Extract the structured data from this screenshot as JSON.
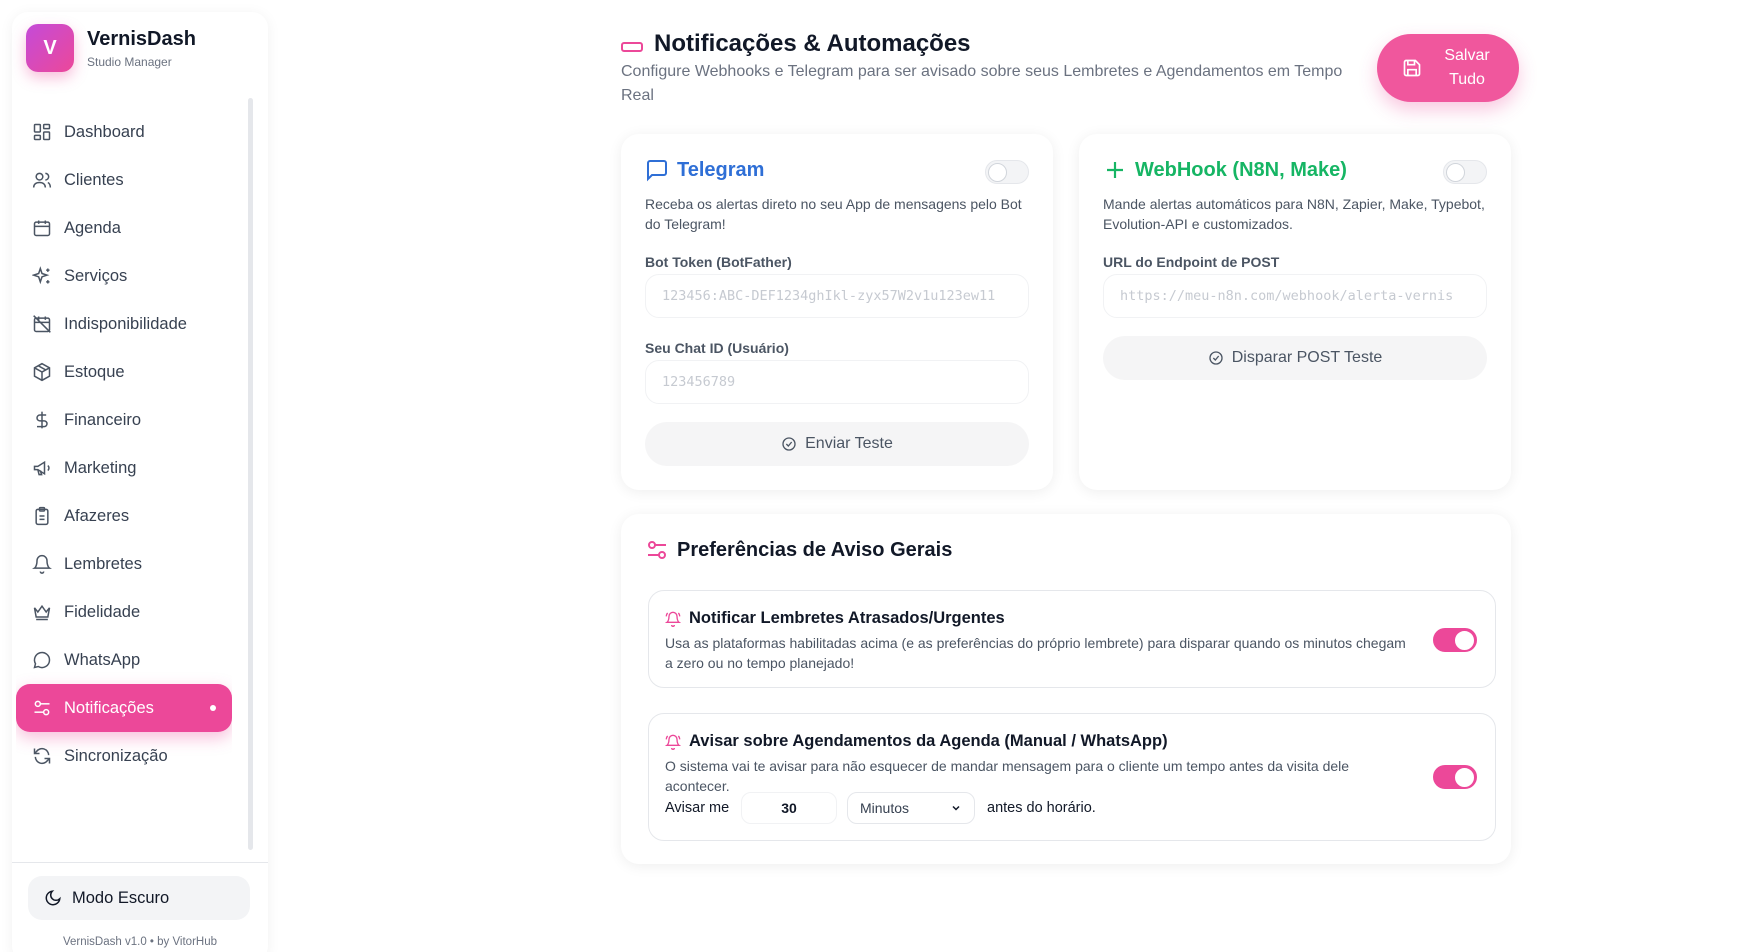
{
  "brand": {
    "logo_letter": "V",
    "title": "VernisDash",
    "subtitle": "Studio Manager"
  },
  "sidebar": {
    "items": [
      {
        "label": "Dashboard",
        "icon": "dashboard-grid-icon"
      },
      {
        "label": "Clientes",
        "icon": "users-icon"
      },
      {
        "label": "Agenda",
        "icon": "calendar-icon"
      },
      {
        "label": "Serviços",
        "icon": "sparkles-icon"
      },
      {
        "label": "Indisponibilidade",
        "icon": "calendar-off-icon"
      },
      {
        "label": "Estoque",
        "icon": "package-icon"
      },
      {
        "label": "Financeiro",
        "icon": "dollar-icon"
      },
      {
        "label": "Marketing",
        "icon": "megaphone-icon"
      },
      {
        "label": "Afazeres",
        "icon": "clipboard-icon"
      },
      {
        "label": "Lembretes",
        "icon": "bell-icon"
      },
      {
        "label": "Fidelidade",
        "icon": "crown-icon"
      },
      {
        "label": "WhatsApp",
        "icon": "chat-bubble-icon"
      },
      {
        "label": "Notificações",
        "icon": "sliders-icon",
        "active": true
      },
      {
        "label": "Sincronização",
        "icon": "refresh-icon"
      }
    ],
    "dark_mode_label": "Modo Escuro",
    "version": "VernisDash v1.0 • by VitorHub"
  },
  "header": {
    "title": "Notificações & Automações",
    "subtitle": "Configure Webhooks e Telegram para ser avisado sobre seus Lembretes e Agendamentos em Tempo Real",
    "save_label": "Salvar Tudo"
  },
  "telegram": {
    "title": "Telegram",
    "description": "Receba os alertas direto no seu App de mensagens pelo Bot do Telegram!",
    "token_label": "Bot Token (BotFather)",
    "token_placeholder": "123456:ABC-DEF1234ghIkl-zyx57W2v1u123ew11",
    "chat_label": "Seu Chat ID (Usuário)",
    "chat_placeholder": "123456789",
    "test_label": "Enviar Teste",
    "enabled": false
  },
  "webhook": {
    "title": "WebHook (N8N, Make)",
    "description": "Mande alertas automáticos para N8N, Zapier, Make, Typebot, Evolution-API e customizados.",
    "url_label": "URL do Endpoint de POST",
    "url_placeholder": "https://meu-n8n.com/webhook/alerta-vernis",
    "test_label": "Disparar POST Teste",
    "enabled": false
  },
  "preferences": {
    "title": "Preferências de Aviso Gerais",
    "items": [
      {
        "title": "Notificar Lembretes Atrasados/Urgentes",
        "description": "Usa as plataformas habilitadas acima (e as preferências do próprio lembrete) para disparar quando os minutos chegam a zero ou no tempo planejado!",
        "enabled": true
      },
      {
        "title": "Avisar sobre Agendamentos da Agenda (Manual / WhatsApp)",
        "description": "O sistema vai te avisar para não esquecer de mandar mensagem para o cliente um tempo antes da visita dele acontecer.",
        "enabled": true,
        "before_label": "Avisar me",
        "amount": "30",
        "unit": "Minutos",
        "after_label": "antes do horário."
      }
    ]
  },
  "colors": {
    "accent": "#ec4899",
    "telegram": "#2f6fd6",
    "webhook": "#16b564"
  }
}
